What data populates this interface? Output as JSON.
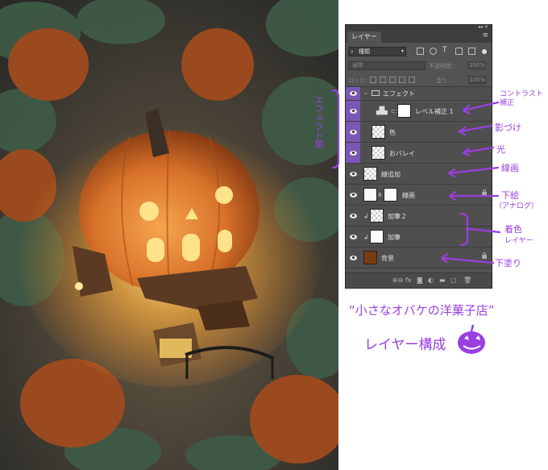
{
  "panel": {
    "tab_label": "レイヤー",
    "kind_filter": "種類",
    "blend_mode": "通常",
    "opacity_label": "不透明度：",
    "opacity_value": "100%",
    "lock_label": "ロック：",
    "fill_label": "塗り：",
    "fill_value": "100%",
    "layers": [
      {
        "name": "エフェクト",
        "type": "group"
      },
      {
        "name": "レベル補正 1",
        "type": "adjustment"
      },
      {
        "name": "色",
        "type": "pixel"
      },
      {
        "name": "おバレイ",
        "type": "pixel"
      },
      {
        "name": "線追加",
        "type": "pixel"
      },
      {
        "name": "線画",
        "type": "pixel"
      },
      {
        "name": "加筆２",
        "type": "pixel"
      },
      {
        "name": "加筆",
        "type": "pixel"
      },
      {
        "name": "背景",
        "type": "pixel"
      }
    ]
  },
  "annotations": {
    "effect_group": "エフェクト類",
    "contrast": "コントラスト補正",
    "color": "影づけ",
    "light": "光",
    "lineart": "線画",
    "sketch_line1": "下絵",
    "sketch_line2": "（アナログ）",
    "paint_line1": "着色",
    "paint_line2": "レイヤー",
    "base": "下塗り",
    "caption_title": "“小さなオバケの洋菓子店”",
    "caption_sub": "レイヤー構成"
  },
  "colors": {
    "annotation": "#9a3fe0",
    "panel_bg": "#535353",
    "pumpkin": "#d9722a"
  }
}
